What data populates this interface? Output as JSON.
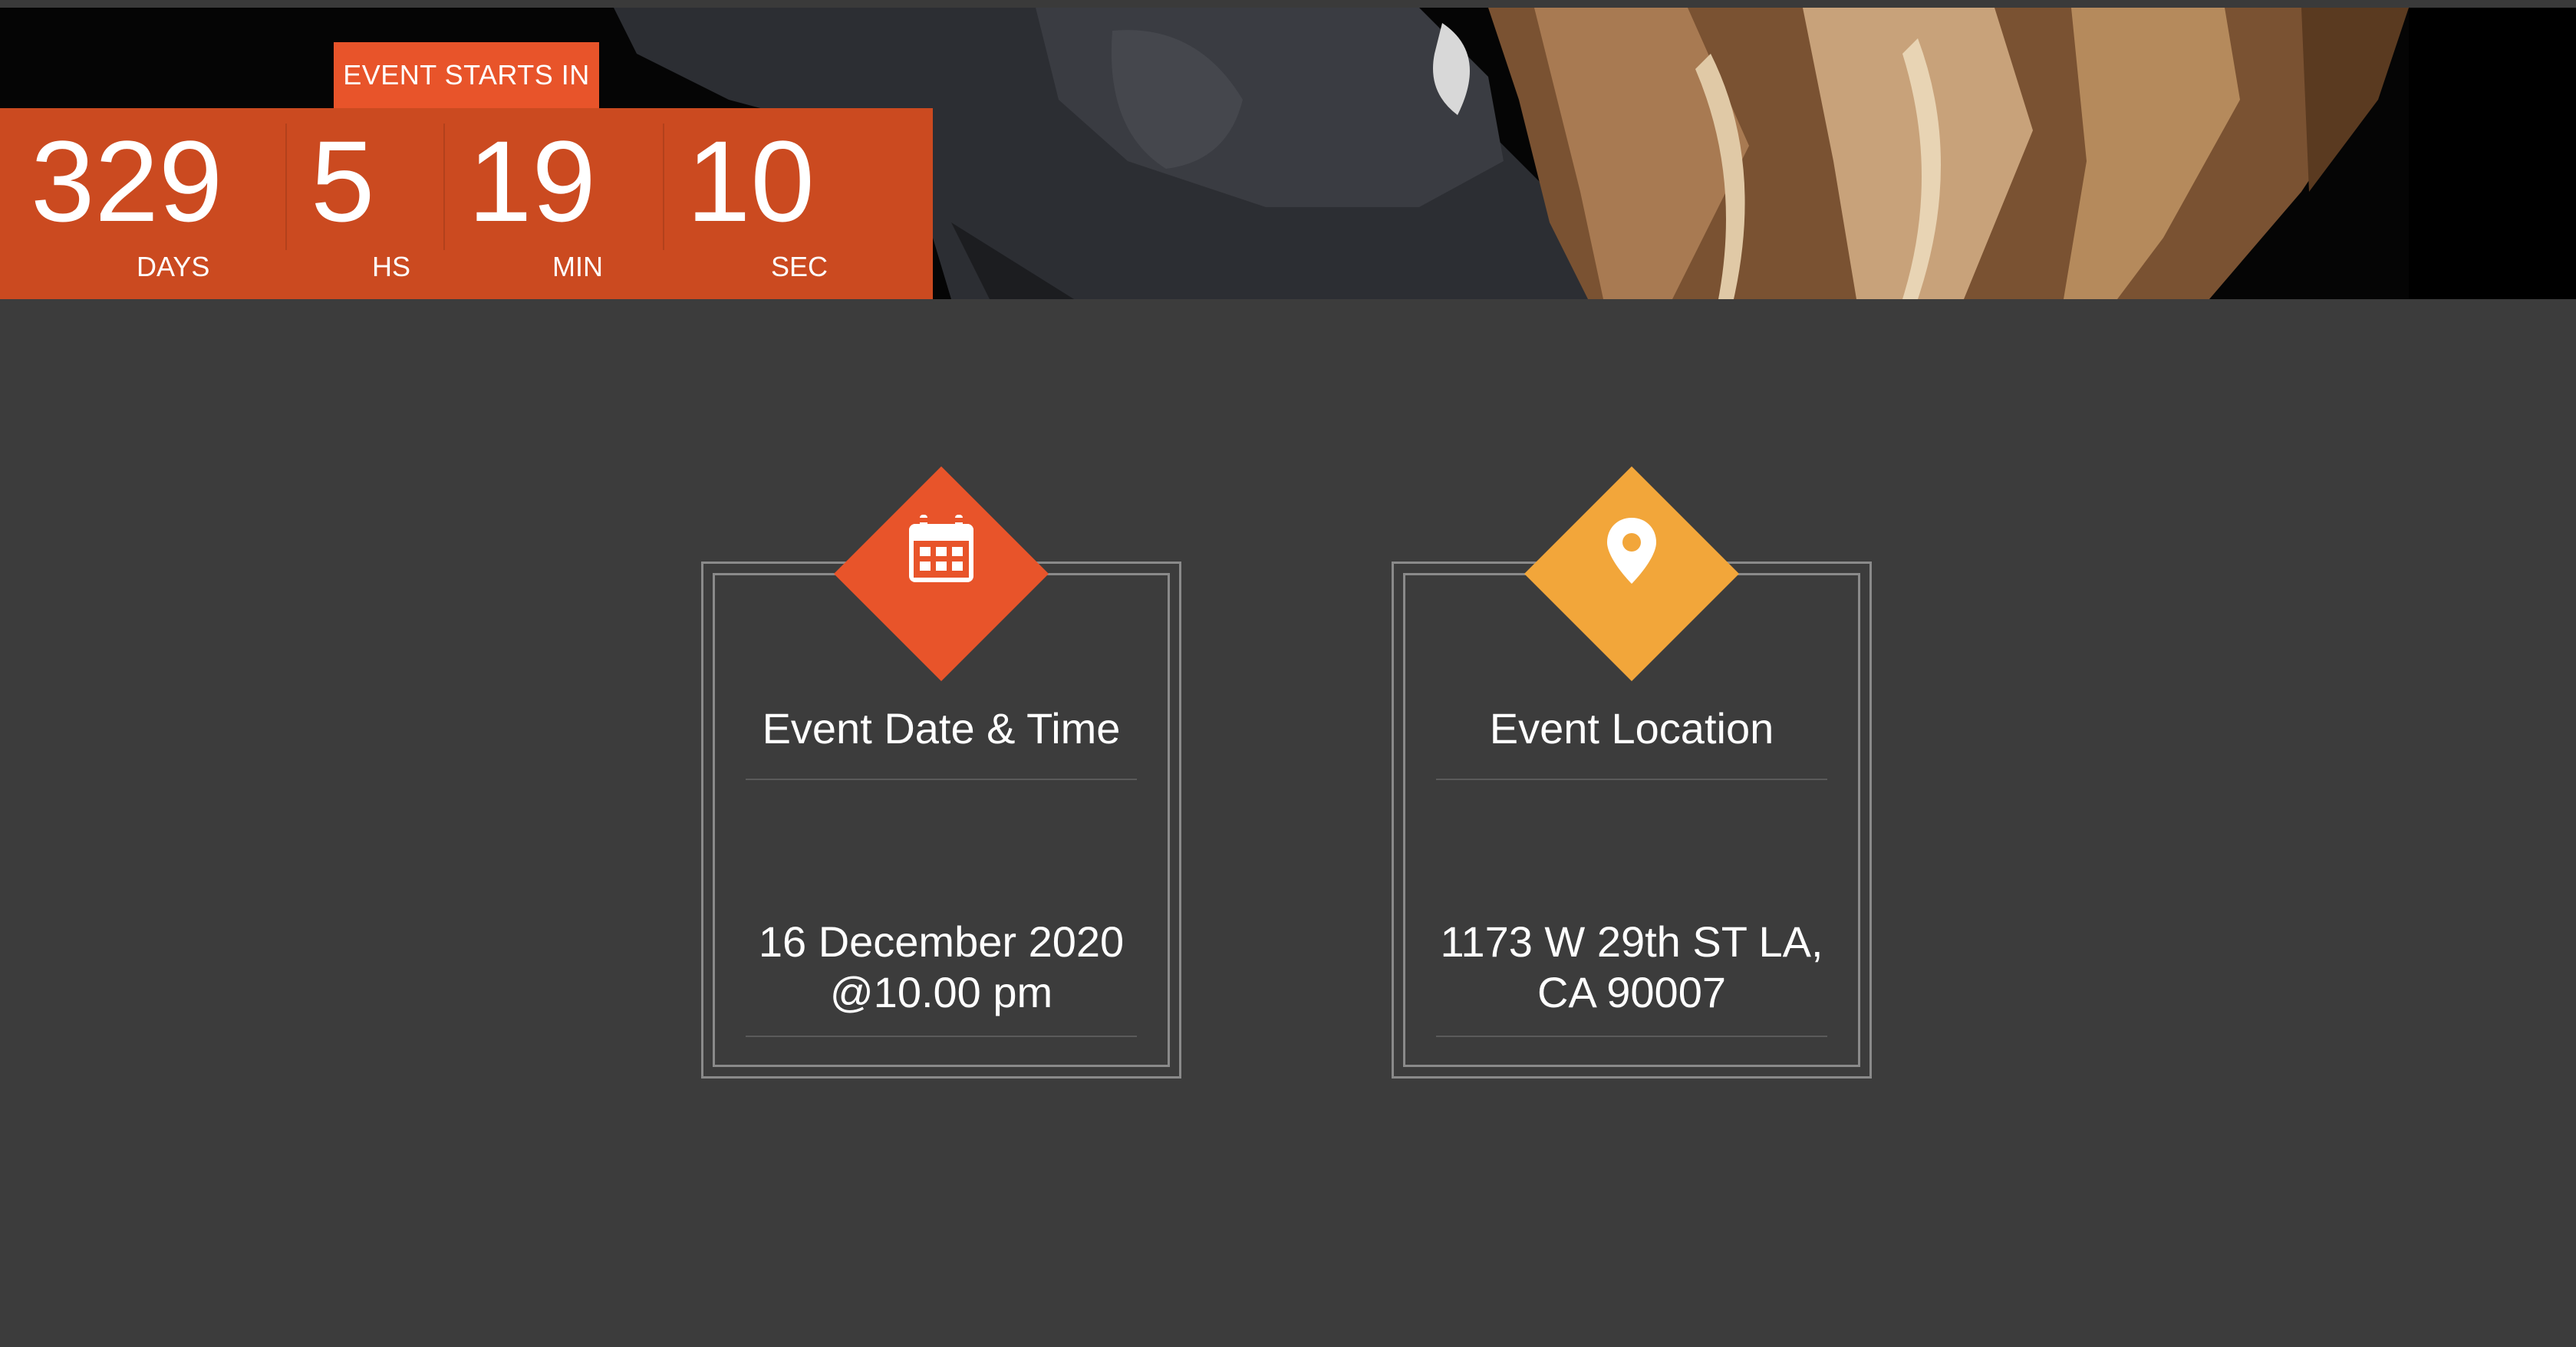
{
  "colors": {
    "background": "#3c3c3c",
    "countdown_bg": "#cb4a20",
    "tab_bg": "#e8542a",
    "accent_orange": "#e8542a",
    "accent_amber": "#f2a63a",
    "card_border": "#8a8a8a"
  },
  "countdown": {
    "heading": "EVENT STARTS IN",
    "units": [
      {
        "value": "329",
        "label": "DAYS"
      },
      {
        "value": "5",
        "label": "HS"
      },
      {
        "value": "19",
        "label": "MIN"
      },
      {
        "value": "10",
        "label": "SEC"
      }
    ]
  },
  "cards": [
    {
      "icon": "calendar-icon",
      "title": "Event Date & Time",
      "line1": "16 December 2020",
      "line2": "@10.00 pm"
    },
    {
      "icon": "map-pin-icon",
      "title": "Event Location",
      "line1": "1173 W 29th ST LA,",
      "line2": "CA 90007"
    }
  ]
}
